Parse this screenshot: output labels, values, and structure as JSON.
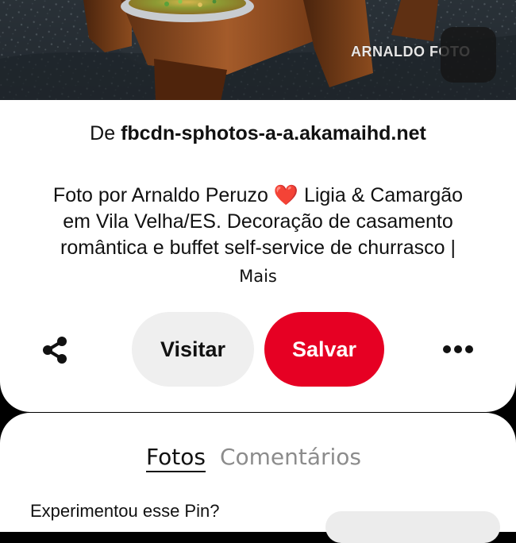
{
  "photo": {
    "watermark": "ARNALDO FOTO",
    "lens_icon": "visual-search-icon"
  },
  "pin": {
    "source_prefix": "De",
    "source_domain": "fbcdn-sphotos-a-a.akamaihd.net",
    "description_lines": [
      "Foto por Arnaldo Peruzo ❤️ Ligia & Camargão",
      "em Vila Velha/ES. Decoração de casamento",
      "romântica e buffet self-service de churrasco |"
    ],
    "more_label": "Mais"
  },
  "actions": {
    "share_icon": "share-icon",
    "visit_label": "Visitar",
    "save_label": "Salvar",
    "more_options_icon": "more-options-icon",
    "save_color": "#e60023"
  },
  "lower_section": {
    "tabs": [
      {
        "label": "Fotos",
        "active": true
      },
      {
        "label": "Comentários",
        "active": false
      }
    ],
    "tried_prompt": "Experimentou esse Pin?"
  }
}
